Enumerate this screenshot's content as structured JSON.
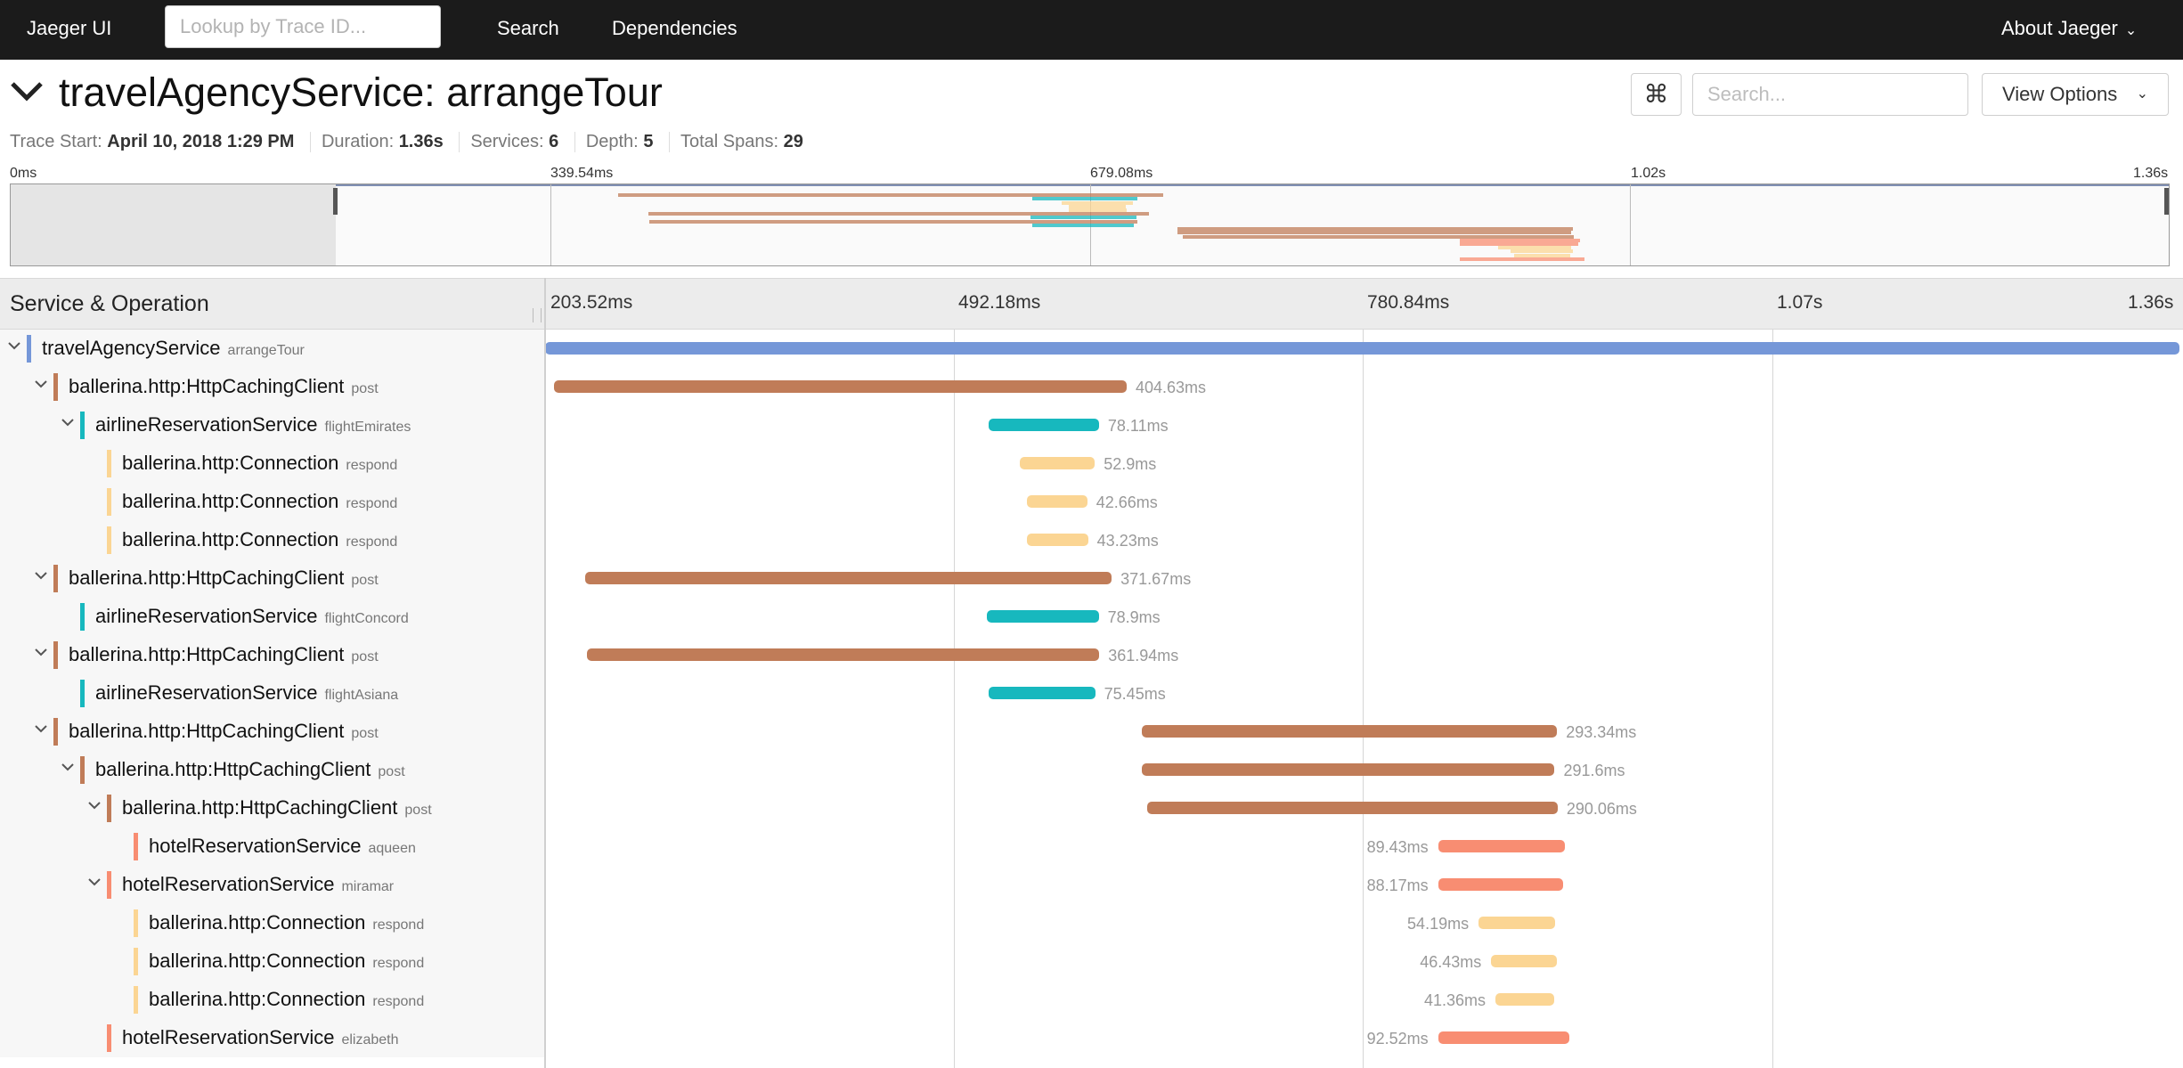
{
  "nav": {
    "brand": "Jaeger UI",
    "lookup_placeholder": "Lookup by Trace ID...",
    "search": "Search",
    "dependencies": "Dependencies",
    "about": "About Jaeger"
  },
  "trace": {
    "service": "travelAgencyService",
    "operation": "arrangeTour",
    "title": "travelAgencyService: arrangeTour",
    "search_placeholder": "Search...",
    "view_options": "View Options",
    "meta": [
      {
        "label": "Trace Start:",
        "value": "April 10, 2018 1:29 PM"
      },
      {
        "label": "Duration:",
        "value": "1.36s"
      },
      {
        "label": "Services:",
        "value": "6"
      },
      {
        "label": "Depth:",
        "value": "5"
      },
      {
        "label": "Total Spans:",
        "value": "29"
      }
    ]
  },
  "minimap": {
    "ticks": [
      "0ms",
      "339.54ms",
      "679.08ms",
      "1.02s",
      "1.36s"
    ]
  },
  "timeline": {
    "header_title": "Service & Operation",
    "ticks": [
      "203.52ms",
      "492.18ms",
      "780.84ms",
      "1.07s",
      "1.36s"
    ]
  },
  "colors": {
    "travelAgencyService": "#7597d8",
    "ballerina.http:HttpCachingClient": "#c07c58",
    "airlineReservationService": "#17b8be",
    "ballerina.http:Connection": "#fbd593",
    "hotelReservationService": "#f88d72"
  },
  "spans": [
    {
      "service": "travelAgencyService",
      "operation": "arrangeTour",
      "depth": 0,
      "toggle": true,
      "start_ms": 203.52,
      "duration_ms": 1156.48,
      "duration_label": ""
    },
    {
      "service": "ballerina.http:HttpCachingClient",
      "operation": "post",
      "depth": 1,
      "toggle": true,
      "start_ms": 209.5,
      "duration_ms": 404.63,
      "duration_label": "404.63ms"
    },
    {
      "service": "airlineReservationService",
      "operation": "flightEmirates",
      "depth": 2,
      "toggle": true,
      "start_ms": 516.5,
      "duration_ms": 78.11,
      "duration_label": "78.11ms"
    },
    {
      "service": "ballerina.http:Connection",
      "operation": "respond",
      "depth": 3,
      "toggle": false,
      "start_ms": 538.8,
      "duration_ms": 52.9,
      "duration_label": "52.9ms"
    },
    {
      "service": "ballerina.http:Connection",
      "operation": "respond",
      "depth": 3,
      "toggle": false,
      "start_ms": 543.7,
      "duration_ms": 42.66,
      "duration_label": "42.66ms"
    },
    {
      "service": "ballerina.http:Connection",
      "operation": "respond",
      "depth": 3,
      "toggle": false,
      "start_ms": 543.7,
      "duration_ms": 43.23,
      "duration_label": "43.23ms"
    },
    {
      "service": "ballerina.http:HttpCachingClient",
      "operation": "post",
      "depth": 1,
      "toggle": true,
      "start_ms": 231.9,
      "duration_ms": 371.67,
      "duration_label": "371.67ms"
    },
    {
      "service": "airlineReservationService",
      "operation": "flightConcord",
      "depth": 2,
      "toggle": false,
      "start_ms": 515.5,
      "duration_ms": 78.9,
      "duration_label": "78.9ms"
    },
    {
      "service": "ballerina.http:HttpCachingClient",
      "operation": "post",
      "depth": 1,
      "toggle": true,
      "start_ms": 232.9,
      "duration_ms": 361.94,
      "duration_label": "361.94ms"
    },
    {
      "service": "airlineReservationService",
      "operation": "flightAsiana",
      "depth": 2,
      "toggle": false,
      "start_ms": 516.5,
      "duration_ms": 75.45,
      "duration_label": "75.45ms"
    },
    {
      "service": "ballerina.http:HttpCachingClient",
      "operation": "post",
      "depth": 1,
      "toggle": true,
      "start_ms": 624.7,
      "duration_ms": 293.34,
      "duration_label": "293.34ms"
    },
    {
      "service": "ballerina.http:HttpCachingClient",
      "operation": "post",
      "depth": 2,
      "toggle": true,
      "start_ms": 624.7,
      "duration_ms": 291.6,
      "duration_label": "291.6ms"
    },
    {
      "service": "ballerina.http:HttpCachingClient",
      "operation": "post",
      "depth": 3,
      "toggle": true,
      "start_ms": 628.4,
      "duration_ms": 290.06,
      "duration_label": "290.06ms"
    },
    {
      "service": "hotelReservationService",
      "operation": "aqueen",
      "depth": 4,
      "toggle": false,
      "start_ms": 834.0,
      "duration_ms": 89.43,
      "duration_label": "89.43ms",
      "label_before": true
    },
    {
      "service": "hotelReservationService",
      "operation": "miramar",
      "depth": 3,
      "toggle": true,
      "start_ms": 834.0,
      "duration_ms": 88.17,
      "duration_label": "88.17ms",
      "label_before": true
    },
    {
      "service": "ballerina.http:Connection",
      "operation": "respond",
      "depth": 4,
      "toggle": false,
      "start_ms": 862.6,
      "duration_ms": 54.19,
      "duration_label": "54.19ms",
      "label_before": true
    },
    {
      "service": "ballerina.http:Connection",
      "operation": "respond",
      "depth": 4,
      "toggle": false,
      "start_ms": 871.5,
      "duration_ms": 46.43,
      "duration_label": "46.43ms",
      "label_before": true
    },
    {
      "service": "ballerina.http:Connection",
      "operation": "respond",
      "depth": 4,
      "toggle": false,
      "start_ms": 874.5,
      "duration_ms": 41.36,
      "duration_label": "41.36ms",
      "label_before": true
    },
    {
      "service": "hotelReservationService",
      "operation": "elizabeth",
      "depth": 3,
      "toggle": false,
      "start_ms": 834.0,
      "duration_ms": 92.52,
      "duration_label": "92.52ms",
      "label_before": true
    }
  ]
}
